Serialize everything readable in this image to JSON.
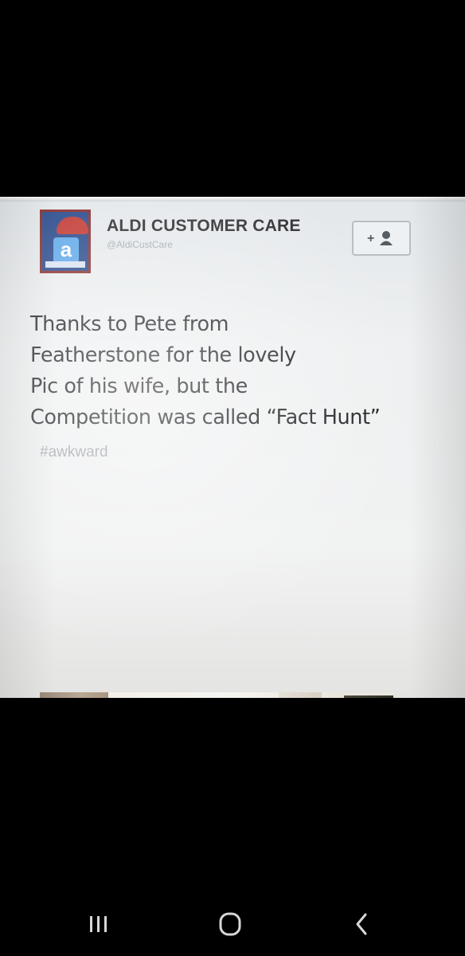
{
  "tweet": {
    "account_name": "ALDI CUSTOMER CARE",
    "handle": "@AldiCustCare",
    "follow_label": "+",
    "text_lines": [
      "Thanks to Pete from",
      "Featherstone for the lovely",
      "Pic of his wife, but the",
      "Competition was called “Fact Hunt”"
    ],
    "hashtag": "#awkward"
  },
  "avatar": {
    "letter": "a"
  },
  "nav_bar": {
    "items": [
      "recent-apps-icon",
      "home-icon",
      "back-icon"
    ]
  },
  "colors": {
    "background": "#000000",
    "card": "#eef0f1",
    "avatar_blue": "#2a4a8c",
    "hat_red": "#c23a33"
  }
}
